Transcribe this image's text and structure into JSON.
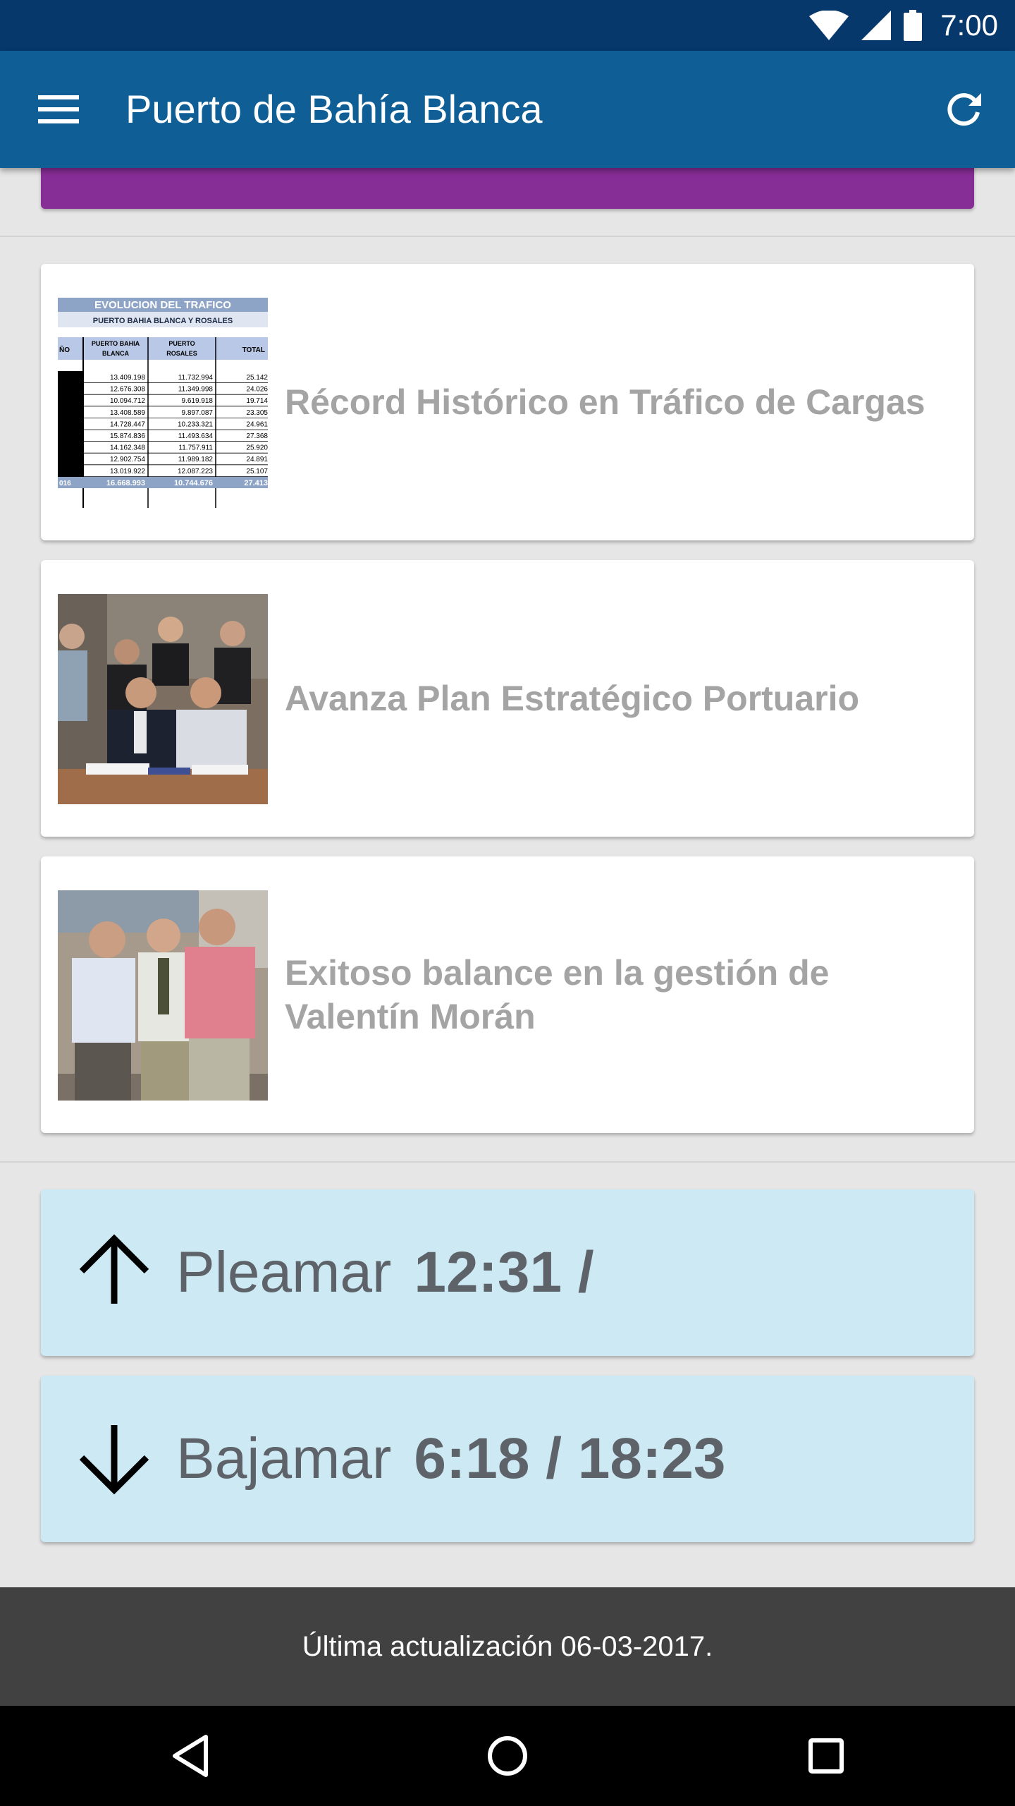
{
  "status_bar": {
    "time": "7:00",
    "icons": [
      "wifi-icon",
      "signal-icon",
      "battery-icon"
    ]
  },
  "app_bar": {
    "title": "Puerto de Bahía Blanca",
    "menu_icon": "hamburger-menu-icon",
    "refresh_icon": "refresh-icon",
    "background_color": "#0f5f96"
  },
  "banner": {
    "color": "#872d96"
  },
  "news": [
    {
      "title": "Récord Histórico en Tráfico de Cargas",
      "thumbnail": {
        "type": "table-image",
        "heading": "EVOLUCION DEL TRAFICO",
        "subheading": "PUERTO BAHIA BLANCA Y ROSALES",
        "columns": [
          "ÑO",
          "PUERTO BAHIA BLANCA",
          "PUERTO ROSALES",
          "TOTAL"
        ],
        "rows": [
          [
            "",
            "13.409.198",
            "11.732.994",
            "25.142"
          ],
          [
            "",
            "12.676.308",
            "11.349.998",
            "24.026"
          ],
          [
            "",
            "10.094.712",
            "9.619.918",
            "19.714"
          ],
          [
            "",
            "13.408.589",
            "9.897.087",
            "23.305"
          ],
          [
            "",
            "14.728.447",
            "10.233.321",
            "24.961"
          ],
          [
            "",
            "15.874.836",
            "11.493.634",
            "27.368"
          ],
          [
            "",
            "14.162.348",
            "11.757.911",
            "25.920"
          ],
          [
            "",
            "12.902.754",
            "11.989.182",
            "24.891"
          ],
          [
            "",
            "13.019.922",
            "12.087.223",
            "25.107"
          ]
        ],
        "total_row": [
          "016",
          "16.668.993",
          "10.744.676",
          "27.413"
        ]
      }
    },
    {
      "title": "Avanza Plan Estratégico Portuario",
      "thumbnail": {
        "type": "photo",
        "subject": "group-signing-photo"
      }
    },
    {
      "title": "Exitoso balance en la gestión de Valentín Morán",
      "thumbnail": {
        "type": "photo",
        "subject": "three-men-photo"
      }
    }
  ],
  "tides": [
    {
      "label": "Pleamar",
      "times": "12:31 /",
      "icon": "arrow-up-icon"
    },
    {
      "label": "Bajamar",
      "times": "6:18 / 18:23",
      "icon": "arrow-down-icon"
    }
  ],
  "footer": {
    "text": "Última actualización 06-03-2017."
  },
  "nav_bar": {
    "buttons": [
      "back-icon",
      "home-icon",
      "recents-icon"
    ]
  }
}
